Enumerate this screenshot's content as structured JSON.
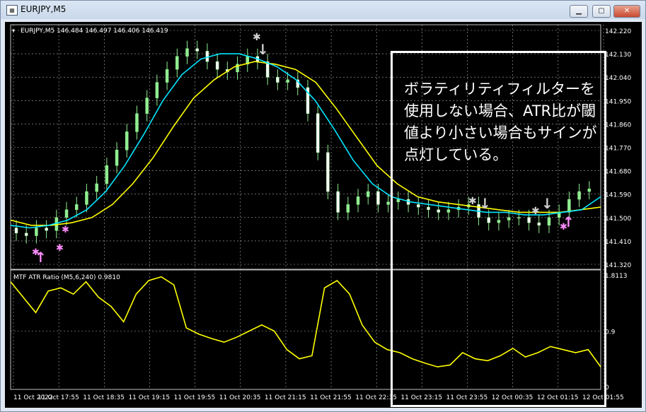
{
  "window": {
    "title": "EURJPY,M5",
    "icon_name": "chart-window-icon",
    "buttons": [
      "minimize",
      "maximize",
      "close"
    ]
  },
  "chart": {
    "header": "EURJPY,M5  146.484 146.497 146.406 146.419",
    "indicator_header": "MTF ATR Ratio  (M5,6,240) 0.9810",
    "annotation": "ボラティリティフィルターを使用しない場合、ATR比が閾値より小さい場合もサインが点灯している。",
    "colors": {
      "background": "#000000",
      "grid": "#b0b0b0",
      "bull_candle": "#90ee90",
      "bear_candle": "#ffffff",
      "ma_fast": "#00e5ff",
      "ma_slow": "#ffff00",
      "atr_line": "#ffff00",
      "sell_arrow": "#d0d0d0",
      "buy_arrow": "#ff8cff"
    }
  },
  "chart_data": [
    {
      "type": "candlestick",
      "title": "EURJPY,M5",
      "y_ticks": [
        "142.220",
        "142.130",
        "142.040",
        "141.950",
        "141.860",
        "141.770",
        "141.680",
        "141.590",
        "141.500",
        "141.410",
        "141.320"
      ],
      "ylim": [
        141.32,
        142.22
      ],
      "x_ticks": [
        "11 Oct 2022",
        "11 Oct 17:55",
        "11 Oct 18:35",
        "11 Oct 19:15",
        "11 Oct 19:55",
        "11 Oct 20:35",
        "11 Oct 21:15",
        "11 Oct 21:55",
        "11 Oct 22:35",
        "11 Oct 23:15",
        "11 Oct 23:55",
        "12 Oct 00:35",
        "12 Oct 01:15",
        "12 Oct 01:55"
      ],
      "series": [
        {
          "name": "close",
          "values": [
            141.44,
            141.43,
            141.46,
            141.45,
            141.5,
            141.53,
            141.55,
            141.6,
            141.63,
            141.7,
            141.76,
            141.83,
            141.9,
            141.96,
            142.02,
            142.07,
            142.12,
            142.15,
            142.14,
            142.1,
            142.07,
            142.06,
            142.09,
            142.12,
            142.1,
            142.04,
            142.02,
            142.03,
            142.0,
            141.9,
            141.75,
            141.6,
            141.52,
            141.55,
            141.58,
            141.6,
            141.55,
            141.56,
            141.57,
            141.55,
            141.54,
            141.53,
            141.52,
            141.53,
            141.54,
            141.55,
            141.5,
            141.48,
            141.49,
            141.5,
            141.5,
            141.48,
            141.47,
            141.5,
            141.52,
            141.57,
            141.6,
            141.61
          ]
        },
        {
          "name": "ma_fast",
          "values": [
            141.47,
            141.46,
            141.47,
            141.49,
            141.53,
            141.6,
            141.7,
            141.82,
            141.95,
            142.05,
            142.11,
            142.13,
            142.13,
            142.11,
            142.08,
            142.03,
            141.95,
            141.84,
            141.72,
            141.63,
            141.58,
            141.56,
            141.55,
            141.54,
            141.53,
            141.52,
            141.52,
            141.51,
            141.51,
            141.52,
            141.53,
            141.58
          ]
        },
        {
          "name": "ma_slow",
          "values": [
            141.49,
            141.47,
            141.47,
            141.48,
            141.5,
            141.55,
            141.63,
            141.73,
            141.85,
            141.96,
            142.03,
            142.08,
            142.1,
            142.09,
            142.07,
            142.02,
            141.92,
            141.81,
            141.7,
            141.63,
            141.58,
            141.56,
            141.55,
            141.54,
            141.53,
            141.52,
            141.52,
            141.52,
            141.53,
            141.54
          ]
        }
      ]
    },
    {
      "type": "line",
      "title": "MTF ATR Ratio  (M5,6,240) 0.9810",
      "y_ticks": [
        "1.8113",
        "0.9",
        "0"
      ],
      "ylim": [
        0,
        1.8113
      ],
      "series": [
        {
          "name": "atr_ratio",
          "values": [
            1.7,
            1.45,
            1.2,
            1.55,
            1.6,
            1.5,
            1.7,
            1.45,
            1.3,
            1.05,
            1.5,
            1.72,
            1.78,
            1.65,
            0.95,
            0.85,
            0.78,
            0.72,
            0.8,
            0.9,
            1.0,
            0.9,
            0.6,
            0.45,
            0.5,
            1.6,
            1.72,
            1.5,
            1.0,
            0.72,
            0.6,
            0.55,
            0.45,
            0.38,
            0.32,
            0.35,
            0.55,
            0.45,
            0.42,
            0.5,
            0.62,
            0.48,
            0.55,
            0.65,
            0.6,
            0.55,
            0.6,
            0.32
          ]
        }
      ]
    }
  ],
  "signals": {
    "sell_arrows": 4,
    "buy_arrows": 3
  }
}
